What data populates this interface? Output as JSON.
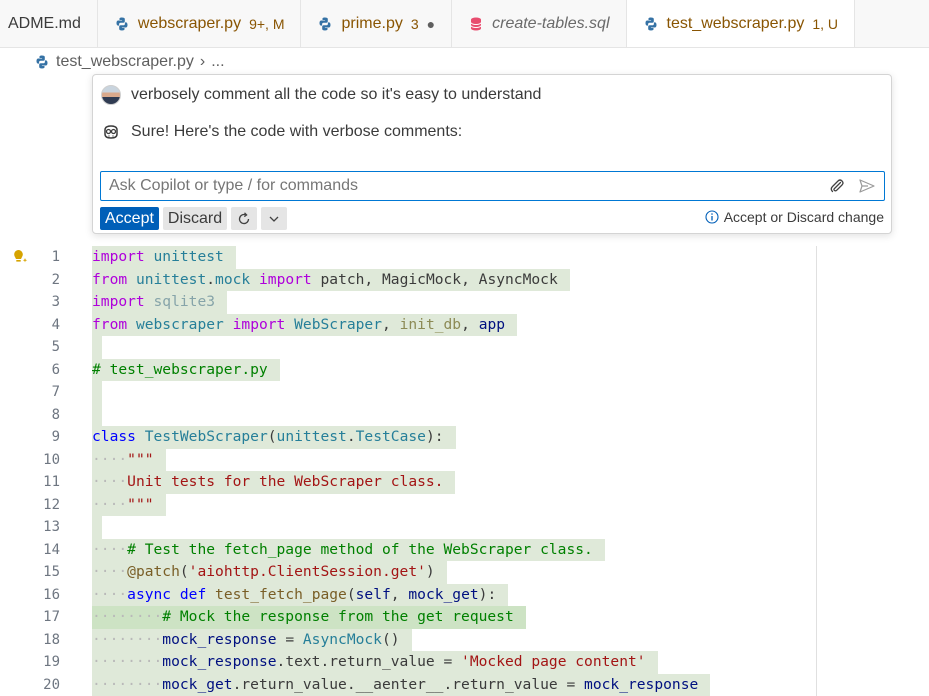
{
  "tabs": [
    {
      "label": "ADME.md",
      "style": "plain",
      "badge": "",
      "dirty": false
    },
    {
      "label": "webscraper.py",
      "style": "modified",
      "badge": "9+, M",
      "dirty": false
    },
    {
      "label": "prime.py",
      "style": "modified",
      "badge": "3",
      "dirty": true
    },
    {
      "label": "create-tables.sql",
      "style": "italic",
      "badge": "",
      "dirty": false
    },
    {
      "label": "test_webscraper.py",
      "style": "modified",
      "badge": "1, U",
      "dirty": false,
      "active": true
    }
  ],
  "breadcrumb": {
    "file": "test_webscraper.py",
    "separator": "›",
    "more": "..."
  },
  "chat": {
    "user_message": "verbosely comment all the code so it's easy to understand",
    "bot_message": "Sure! Here's the code with verbose comments:",
    "input_placeholder": "Ask Copilot or type / for commands",
    "accept_label": "Accept",
    "discard_label": "Discard",
    "hint": "Accept or Discard change"
  },
  "colors": {
    "accent": "#005fb8",
    "focus_border": "#0078d4",
    "diff_inserted_bg": "#dfe9d9",
    "modified_tab_text": "#895503"
  },
  "code_lines": [
    {
      "n": "1",
      "tokens": [
        [
          "k",
          "import"
        ],
        [
          "plain",
          " "
        ],
        [
          "cls",
          "unittest"
        ]
      ]
    },
    {
      "n": "2",
      "tokens": [
        [
          "k",
          "from"
        ],
        [
          "plain",
          " "
        ],
        [
          "cls",
          "unittest"
        ],
        [
          "plain",
          "."
        ],
        [
          "cls",
          "mock"
        ],
        [
          "plain",
          " "
        ],
        [
          "k",
          "import"
        ],
        [
          "plain",
          " patch, MagicMock, AsyncMock"
        ]
      ]
    },
    {
      "n": "3",
      "tokens": [
        [
          "k",
          "import"
        ],
        [
          "plain",
          " "
        ],
        [
          "dim",
          "sqlite3"
        ]
      ]
    },
    {
      "n": "4",
      "tokens": [
        [
          "k",
          "from"
        ],
        [
          "plain",
          " "
        ],
        [
          "cls",
          "webscraper"
        ],
        [
          "plain",
          " "
        ],
        [
          "k",
          "import"
        ],
        [
          "plain",
          " "
        ],
        [
          "cls",
          "WebScraper"
        ],
        [
          "plain",
          ", "
        ],
        [
          "dimfn",
          "init_db"
        ],
        [
          "plain",
          ", "
        ],
        [
          "var",
          "app"
        ]
      ]
    },
    {
      "n": "5",
      "tokens": []
    },
    {
      "n": "6",
      "tokens": [
        [
          "cmt",
          "# test_webscraper.py"
        ]
      ]
    },
    {
      "n": "7",
      "tokens": []
    },
    {
      "n": "8",
      "tokens": []
    },
    {
      "n": "9",
      "tokens": [
        [
          "kb",
          "class"
        ],
        [
          "plain",
          " "
        ],
        [
          "cls",
          "TestWebScraper"
        ],
        [
          "plain",
          "("
        ],
        [
          "cls",
          "unittest"
        ],
        [
          "plain",
          "."
        ],
        [
          "cls",
          "TestCase"
        ],
        [
          "plain",
          "):"
        ]
      ]
    },
    {
      "n": "10",
      "tokens": [
        [
          "ws",
          "····"
        ],
        [
          "str",
          "\"\"\""
        ]
      ]
    },
    {
      "n": "11",
      "tokens": [
        [
          "ws",
          "····"
        ],
        [
          "str",
          "Unit tests for the WebScraper class."
        ]
      ]
    },
    {
      "n": "12",
      "tokens": [
        [
          "ws",
          "····"
        ],
        [
          "str",
          "\"\"\""
        ]
      ]
    },
    {
      "n": "13",
      "tokens": []
    },
    {
      "n": "14",
      "tokens": [
        [
          "ws",
          "····"
        ],
        [
          "cmt",
          "# Test the fetch_page method of the WebScraper class."
        ]
      ]
    },
    {
      "n": "15",
      "tokens": [
        [
          "ws",
          "····"
        ],
        [
          "fn",
          "@patch"
        ],
        [
          "plain",
          "("
        ],
        [
          "str",
          "'aiohttp.ClientSession.get'"
        ],
        [
          "plain",
          ")"
        ]
      ]
    },
    {
      "n": "16",
      "tokens": [
        [
          "ws",
          "····"
        ],
        [
          "kb",
          "async"
        ],
        [
          "plain",
          " "
        ],
        [
          "kb",
          "def"
        ],
        [
          "plain",
          " "
        ],
        [
          "fn",
          "test_fetch_page"
        ],
        [
          "plain",
          "("
        ],
        [
          "var",
          "self"
        ],
        [
          "plain",
          ", "
        ],
        [
          "var",
          "mock_get"
        ],
        [
          "plain",
          "):"
        ]
      ]
    },
    {
      "n": "17",
      "tokens": [
        [
          "ws",
          "········"
        ],
        [
          "cmt",
          "# Mock the response from the get request"
        ]
      ],
      "bright": true
    },
    {
      "n": "18",
      "tokens": [
        [
          "ws",
          "········"
        ],
        [
          "var",
          "mock_response"
        ],
        [
          "plain",
          " = "
        ],
        [
          "cls",
          "AsyncMock"
        ],
        [
          "plain",
          "()"
        ]
      ]
    },
    {
      "n": "19",
      "tokens": [
        [
          "ws",
          "········"
        ],
        [
          "var",
          "mock_response"
        ],
        [
          "plain",
          ".text.return_value = "
        ],
        [
          "str",
          "'Mocked page content'"
        ]
      ]
    },
    {
      "n": "20",
      "tokens": [
        [
          "ws",
          "········"
        ],
        [
          "var",
          "mock_get"
        ],
        [
          "plain",
          ".return_value.__aenter__.return_value = "
        ],
        [
          "var",
          "mock_response"
        ]
      ]
    }
  ]
}
